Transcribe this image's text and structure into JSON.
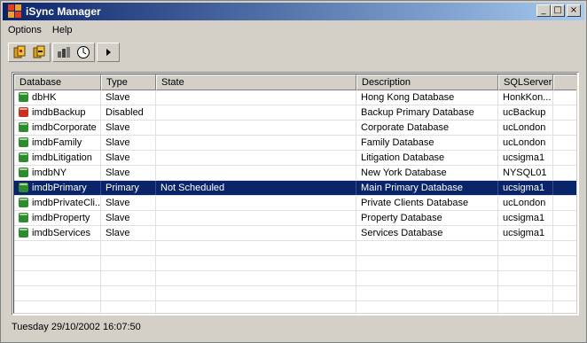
{
  "window": {
    "title": "iSync Manager",
    "buttons": {
      "minimize": "_",
      "maximize": "□",
      "close": "×"
    }
  },
  "menu": [
    "Options",
    "Help"
  ],
  "toolbar": {
    "icons": [
      "database-add-icon",
      "database-remove-icon",
      "database-sync-icon",
      "clock-icon",
      "play-icon"
    ]
  },
  "table": {
    "columns": [
      "Database",
      "Type",
      "State",
      "Description",
      "SQLServer",
      ""
    ],
    "rows": [
      {
        "database": "dbHK",
        "type": "Slave",
        "state": "",
        "description": "Hong Kong Database",
        "server": "HonkKon...",
        "icon_color": "#2e8b2e"
      },
      {
        "database": "imdbBackup",
        "type": "Disabled",
        "state": "",
        "description": "Backup Primary Database",
        "server": "ucBackup",
        "icon_color": "#c83020"
      },
      {
        "database": "imdbCorporate",
        "type": "Slave",
        "state": "",
        "description": "Corporate Database",
        "server": "ucLondon",
        "icon_color": "#2e8b2e"
      },
      {
        "database": "imdbFamily",
        "type": "Slave",
        "state": "",
        "description": "Family Database",
        "server": "ucLondon",
        "icon_color": "#2e8b2e"
      },
      {
        "database": "imdbLitigation",
        "type": "Slave",
        "state": "",
        "description": "Litigation Database",
        "server": "ucsigma1",
        "icon_color": "#2e8b2e"
      },
      {
        "database": "imdbNY",
        "type": "Slave",
        "state": "",
        "description": "New York Database",
        "server": "NYSQL01",
        "icon_color": "#2e8b2e"
      },
      {
        "database": "imdbPrimary",
        "type": "Primary",
        "state": "Not Scheduled",
        "description": "Main Primary Database",
        "server": "ucsigma1",
        "icon_color": "#2e8b2e",
        "selected": true
      },
      {
        "database": "imdbPrivateCli...",
        "type": "Slave",
        "state": "",
        "description": "Private Clients Database",
        "server": "ucLondon",
        "icon_color": "#2e8b2e"
      },
      {
        "database": "imdbProperty",
        "type": "Slave",
        "state": "",
        "description": "Property Database",
        "server": "ucsigma1",
        "icon_color": "#2e8b2e"
      },
      {
        "database": "imdbServices",
        "type": "Slave",
        "state": "",
        "description": "Services Database",
        "server": "ucsigma1",
        "icon_color": "#2e8b2e"
      }
    ],
    "empty_rows": 5
  },
  "status": "Tuesday 29/10/2002 16:07:50"
}
